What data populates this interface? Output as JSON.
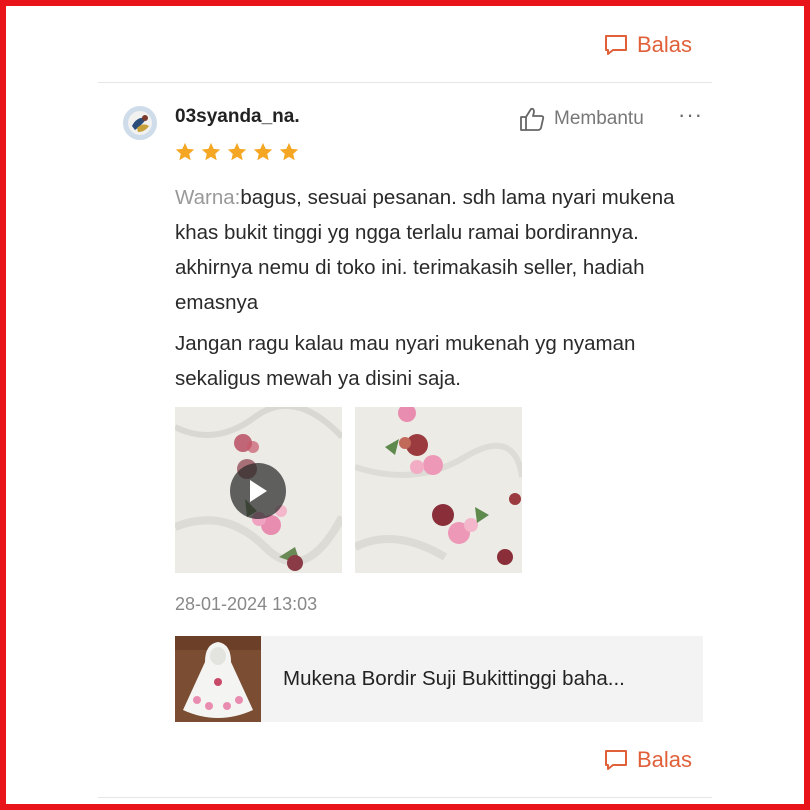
{
  "reply_top": {
    "label": "Balas",
    "icon": "chat-bubble-icon"
  },
  "review": {
    "username": "03syanda_na.",
    "helpful_label": "Membantu",
    "helpful_icon": "thumbs-up-icon",
    "more_label": "···",
    "rating": 5,
    "max_rating": 5,
    "variant_label": "Warna:",
    "text_part1": "bagus, sesuai pesanan. sdh lama nyari mukena khas bukit tinggi yg ngga terlalu ramai bordirannya. akhirnya nemu di toko ini. terimakasih seller, hadiah emasnya",
    "text_part2": "Jangan ragu kalau mau nyari mukenah yg nyaman sekaligus mewah ya disini saja.",
    "media": [
      {
        "type": "video",
        "icon": "play-icon"
      },
      {
        "type": "image"
      }
    ],
    "date": "28-01-2024 13:03"
  },
  "product": {
    "name": "Mukena Bordir Suji Bukittinggi baha..."
  },
  "reply_bottom": {
    "label": "Balas",
    "icon": "chat-bubble-icon"
  },
  "colors": {
    "accent": "#e0603a",
    "star": "#f5a623",
    "frame": "#e8141a"
  }
}
